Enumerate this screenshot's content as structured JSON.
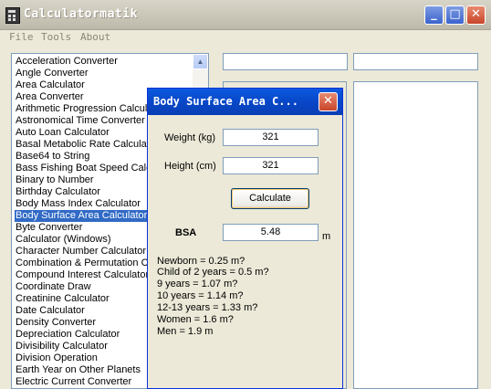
{
  "window": {
    "title": "Calculatormatik"
  },
  "menu": [
    "File",
    "Tools",
    "About"
  ],
  "list": {
    "selected_index": 13,
    "items": [
      "Acceleration Converter",
      "Angle Converter",
      "Area Calculator",
      "Area Converter",
      "Arithmetic Progression Calculator",
      "Astronomical Time Converter",
      "Auto Loan Calculator",
      "Basal Metabolic Rate Calculator",
      "Base64 to String",
      "Bass Fishing Boat Speed Calculator",
      "Binary to Number",
      "Birthday Calculator",
      "Body Mass Index Calculator",
      "Body Surface Area Calculator",
      "Byte Converter",
      "Calculator (Windows)",
      "Character Number Calculator",
      "Combination & Permutation Calculator",
      "Compound Interest Calculator",
      "Coordinate Draw",
      "Creatinine Calculator",
      "Date Calculator",
      "Density Converter",
      "Depreciation Calculator",
      "Divisibility Calculator",
      "Division Operation",
      "Earth Year on Other Planets",
      "Electric Current Converter"
    ]
  },
  "dialog": {
    "title": "Body Surface Area C...",
    "weight_label": "Weight (kg)",
    "weight_value": "321",
    "height_label": "Height (cm)",
    "height_value": "321",
    "calculate_label": "Calculate",
    "bsa_label": "BSA",
    "bsa_value": "5.48",
    "bsa_unit": "m",
    "reference": [
      "Newborn = 0.25 m?",
      "Child of 2 years = 0.5 m?",
      "9 years = 1.07 m?",
      "10 years = 1.14 m?",
      "12-13 years = 1.33 m?",
      "Women = 1.6 m?",
      "Men = 1.9 m"
    ]
  }
}
